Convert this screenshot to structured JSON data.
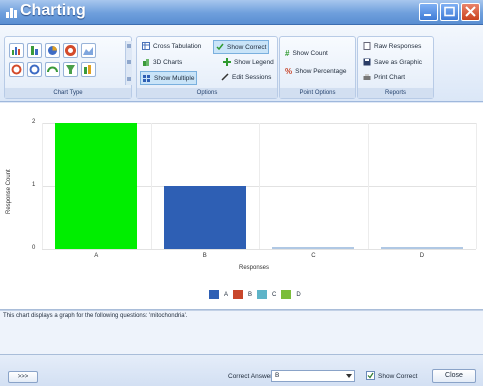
{
  "window": {
    "title": "Charting"
  },
  "ribbon": {
    "chart_type": {
      "label": "Chart Type"
    },
    "options": {
      "label": "Options",
      "cross_tabulation": "Cross Tabulation",
      "show_correct": "Show Correct",
      "charts_3d": "3D Charts",
      "show_legend": "Show Legend",
      "show_multiple": "Show Multiple",
      "edit_sessions": "Edit Sessions"
    },
    "point_options": {
      "label": "Point Options",
      "show_count": "Show Count",
      "show_percentage": "Show Percentage"
    },
    "reports": {
      "label": "Reports",
      "raw_responses": "Raw Responses",
      "save_as_graphic": "Save as Graphic",
      "print_chart": "Print Chart"
    }
  },
  "chart_data": {
    "type": "bar",
    "categories": [
      "A",
      "B",
      "C",
      "D"
    ],
    "values": [
      2,
      1,
      0,
      0
    ],
    "ylabel": "Response Count",
    "xlabel": "Responses",
    "ylim": [
      0,
      2
    ],
    "yticks": [
      "2",
      "1",
      "0"
    ],
    "colors": [
      "#00ee00",
      "#2e5fb4",
      "#b0c8e4",
      "#b0c8e4"
    ],
    "legend": [
      {
        "label": "A",
        "color": "#2e5fb4"
      },
      {
        "label": "B",
        "color": "#c8462b"
      },
      {
        "label": "C",
        "color": "#5eb4c8"
      },
      {
        "label": "D",
        "color": "#7bbd3a"
      }
    ],
    "legend_placement": "bottom-center",
    "grid": true
  },
  "description": {
    "text": "This chart displays a graph for the following questions: 'mitochondria'."
  },
  "footer": {
    "expand_button": ">>>",
    "correct_answer_label": "Correct Answer",
    "correct_answer_value": "B",
    "show_correct_label": "Show Correct",
    "show_correct_checked": true,
    "close_button": "Close"
  }
}
